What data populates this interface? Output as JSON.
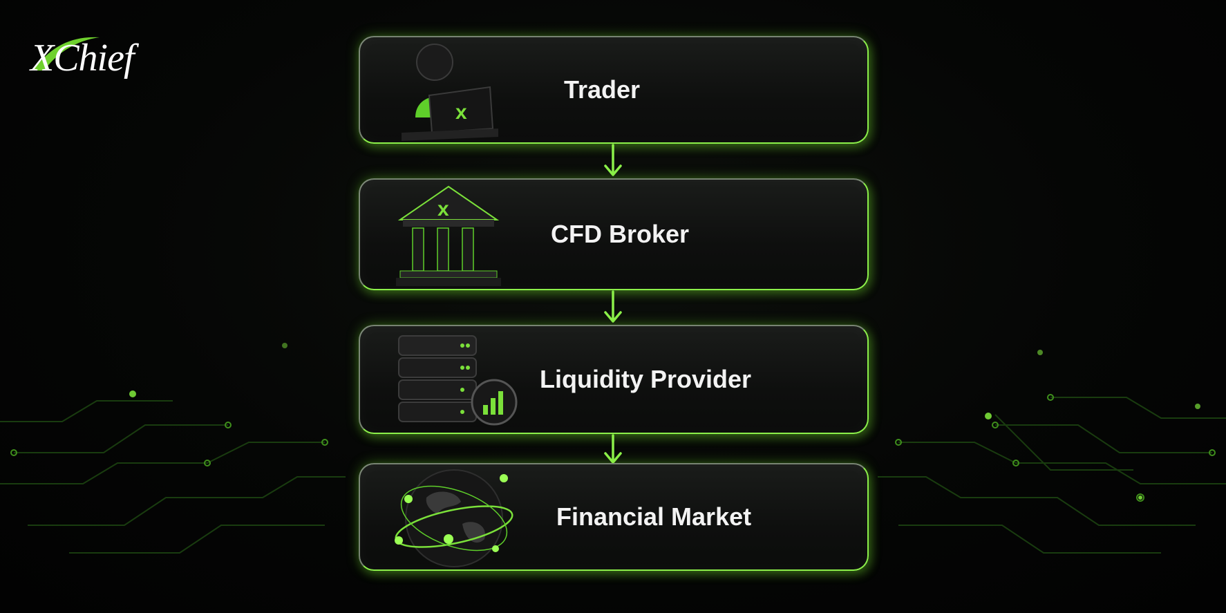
{
  "logo": {
    "text": "XChief"
  },
  "colors": {
    "accent": "#8cf04a",
    "background": "#050605",
    "text": "#f3f3f3"
  },
  "flow": {
    "steps": [
      {
        "label": "Trader",
        "icon": "trader-laptop-icon"
      },
      {
        "label": "CFD Broker",
        "icon": "bank-building-icon"
      },
      {
        "label": "Liquidity Provider",
        "icon": "server-stack-icon"
      },
      {
        "label": "Financial Market",
        "icon": "globe-icon"
      }
    ],
    "connector_icon": "arrow-down-icon"
  }
}
